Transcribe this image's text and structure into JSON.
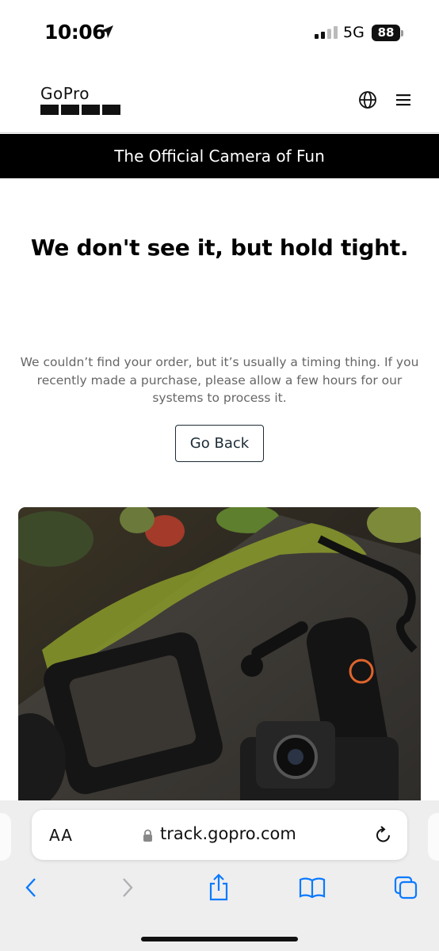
{
  "status_bar": {
    "time": "10:06",
    "network": "5G",
    "battery": "88"
  },
  "header": {
    "logo_text": "GoPro",
    "icons": [
      "globe-icon",
      "hamburger-menu-icon"
    ]
  },
  "banner": {
    "text": "The Official Camera of Fun"
  },
  "main": {
    "headline": "We don't see it, but hold tight.",
    "message": "We couldn’t find your order, but it’s usually a timing thing. If you recently made a purchase, please allow a few hours for our systems to process it.",
    "button_label": "Go Back"
  },
  "browser": {
    "aa_label": "AA",
    "url": "track.gopro.com",
    "icons": [
      "back-icon",
      "forward-icon",
      "share-icon",
      "bookmarks-icon",
      "tabs-icon",
      "reload-icon",
      "lock-icon"
    ]
  },
  "colors": {
    "banner_bg": "#000000",
    "button_border": "#1b2b36",
    "body_text": "#666666",
    "safari_accent": "#0a7aff"
  }
}
